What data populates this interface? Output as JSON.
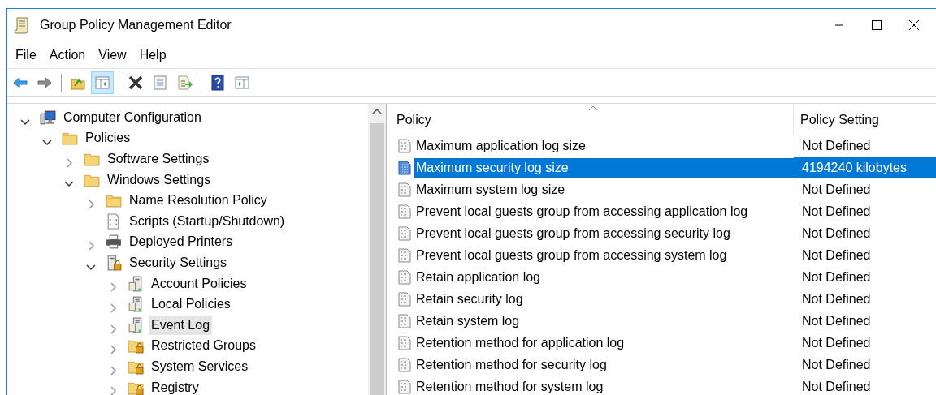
{
  "window": {
    "title": "Group Policy Management Editor"
  },
  "menu": [
    "File",
    "Action",
    "View",
    "Help"
  ],
  "toolbar": [
    {
      "kind": "back",
      "pressed": false
    },
    {
      "kind": "forward",
      "pressed": false
    },
    {
      "kind": "sep"
    },
    {
      "kind": "up",
      "pressed": false
    },
    {
      "kind": "tree",
      "pressed": true
    },
    {
      "kind": "sep"
    },
    {
      "kind": "delete",
      "pressed": false
    },
    {
      "kind": "properties",
      "pressed": false
    },
    {
      "kind": "export",
      "pressed": false
    },
    {
      "kind": "sep"
    },
    {
      "kind": "help",
      "pressed": false
    },
    {
      "kind": "actionpane",
      "pressed": false
    }
  ],
  "tree": [
    {
      "label": "Computer Configuration",
      "kind": "computer",
      "expanded": true,
      "selected": false,
      "children": [
        {
          "label": "Policies",
          "kind": "folder",
          "expanded": true,
          "selected": false,
          "children": [
            {
              "label": "Software Settings",
              "kind": "folder",
              "expanded": false,
              "selected": false
            },
            {
              "label": "Windows Settings",
              "kind": "folder",
              "expanded": true,
              "selected": false,
              "children": [
                {
                  "label": "Name Resolution Policy",
                  "kind": "folder",
                  "expanded": false,
                  "selected": false
                },
                {
                  "label": "Scripts (Startup/Shutdown)",
                  "kind": "script",
                  "selected": false
                },
                {
                  "label": "Deployed Printers",
                  "kind": "printer",
                  "expanded": false,
                  "selected": false
                },
                {
                  "label": "Security Settings",
                  "kind": "secserver",
                  "expanded": true,
                  "selected": false,
                  "children": [
                    {
                      "label": "Account Policies",
                      "kind": "server",
                      "expanded": false,
                      "selected": false
                    },
                    {
                      "label": "Local Policies",
                      "kind": "server",
                      "expanded": false,
                      "selected": false
                    },
                    {
                      "label": "Event Log",
                      "kind": "server",
                      "expanded": false,
                      "selected": true
                    },
                    {
                      "label": "Restricted Groups",
                      "kind": "secfolder",
                      "expanded": false,
                      "selected": false
                    },
                    {
                      "label": "System Services",
                      "kind": "secfolder",
                      "expanded": false,
                      "selected": false
                    },
                    {
                      "label": "Registry",
                      "kind": "secfolder",
                      "expanded": false,
                      "selected": false
                    }
                  ]
                }
              ]
            }
          ]
        }
      ]
    }
  ],
  "table": {
    "columns": [
      "Policy",
      "Policy Setting"
    ],
    "rows": [
      {
        "policy": "Maximum application log size",
        "setting": "Not Defined",
        "selected": false
      },
      {
        "policy": "Maximum security log size",
        "setting": "4194240 kilobytes",
        "selected": true
      },
      {
        "policy": "Maximum system log size",
        "setting": "Not Defined",
        "selected": false
      },
      {
        "policy": "Prevent local guests group from accessing application log",
        "setting": "Not Defined",
        "selected": false
      },
      {
        "policy": "Prevent local guests group from accessing security log",
        "setting": "Not Defined",
        "selected": false
      },
      {
        "policy": "Prevent local guests group from accessing system log",
        "setting": "Not Defined",
        "selected": false
      },
      {
        "policy": "Retain application log",
        "setting": "Not Defined",
        "selected": false
      },
      {
        "policy": "Retain security log",
        "setting": "Not Defined",
        "selected": false
      },
      {
        "policy": "Retain system log",
        "setting": "Not Defined",
        "selected": false
      },
      {
        "policy": "Retention method for application log",
        "setting": "Not Defined",
        "selected": false
      },
      {
        "policy": "Retention method for security log",
        "setting": "Not Defined",
        "selected": false
      },
      {
        "policy": "Retention method for system log",
        "setting": "Not Defined",
        "selected": false
      }
    ]
  }
}
